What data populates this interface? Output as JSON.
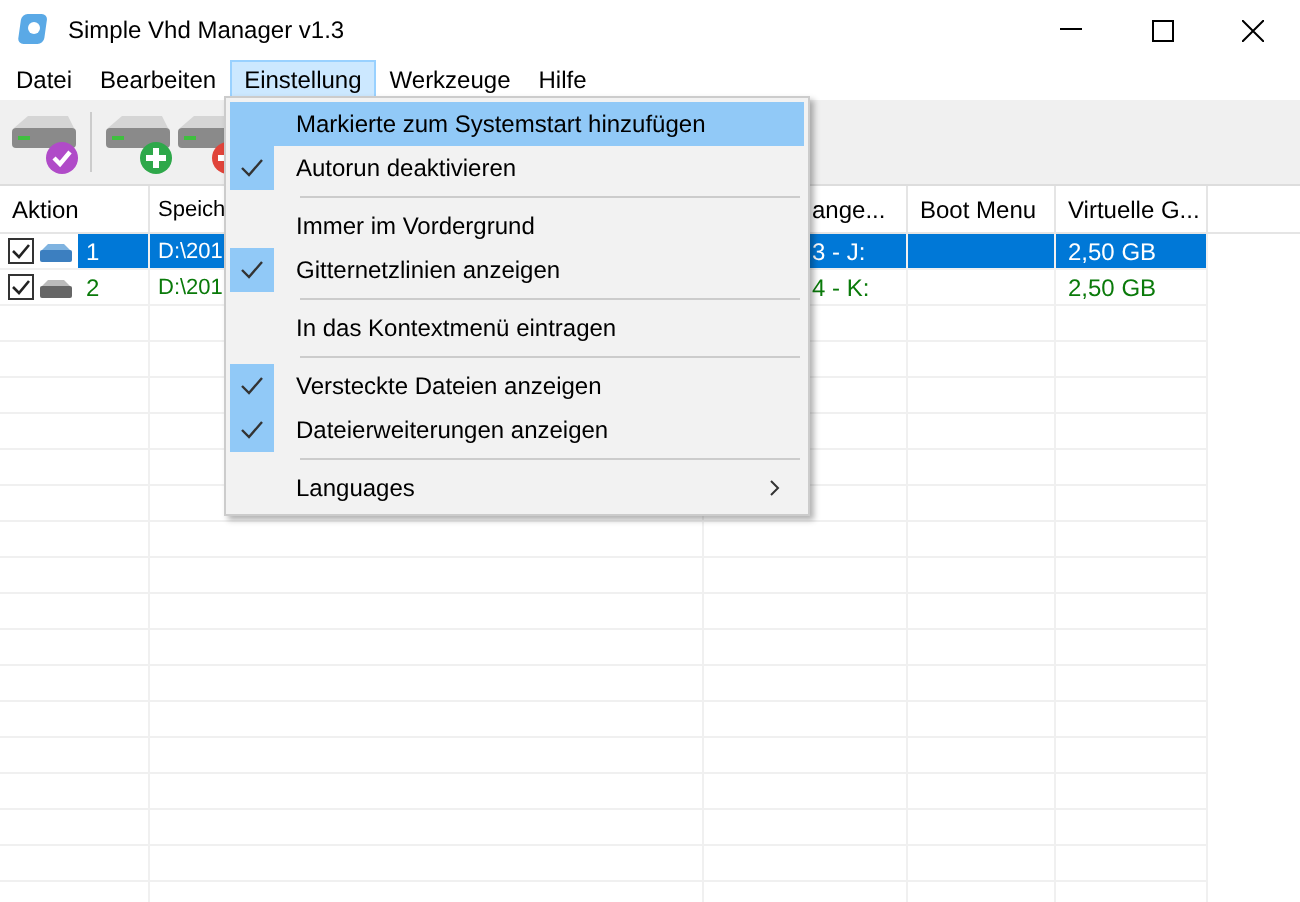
{
  "window": {
    "title": "Simple Vhd Manager v1.3"
  },
  "menu_bar": [
    {
      "label": "Datei",
      "selected": false
    },
    {
      "label": "Bearbeiten",
      "selected": false
    },
    {
      "label": "Einstellung",
      "selected": true
    },
    {
      "label": "Werkzeuge",
      "selected": false
    },
    {
      "label": "Hilfe",
      "selected": false
    }
  ],
  "toolbar": [
    {
      "kind": "check"
    },
    {
      "kind": "separator"
    },
    {
      "kind": "add"
    },
    {
      "kind": "remove"
    }
  ],
  "table": {
    "columns": [
      "Aktion",
      "Speich",
      "ange...",
      "Boot Menu",
      "Virtuelle G..."
    ],
    "rows": [
      {
        "checked": true,
        "selected": true,
        "number": "1",
        "path": "D:\\201",
        "drive": "3 - J:",
        "size": "2,50 GB"
      },
      {
        "checked": true,
        "selected": false,
        "number": "2",
        "path": "D:\\201",
        "drive": "4 - K:",
        "size": "2,50 GB"
      }
    ]
  },
  "dropdown": {
    "items": [
      {
        "kind": "item",
        "label": "Markierte zum Systemstart hinzufügen",
        "checked": false,
        "highlighted": true
      },
      {
        "kind": "item",
        "label": "Autorun deaktivieren",
        "checked": true,
        "highlighted": false
      },
      {
        "kind": "separator"
      },
      {
        "kind": "item",
        "label": "Immer im Vordergrund",
        "checked": false,
        "highlighted": false
      },
      {
        "kind": "item",
        "label": "Gitternetzlinien anzeigen",
        "checked": true,
        "highlighted": false
      },
      {
        "kind": "separator"
      },
      {
        "kind": "item",
        "label": "In das Kontextmenü eintragen",
        "checked": false,
        "highlighted": false
      },
      {
        "kind": "separator"
      },
      {
        "kind": "item",
        "label": "Versteckte Dateien anzeigen",
        "checked": true,
        "highlighted": false
      },
      {
        "kind": "item",
        "label": "Dateierweiterungen anzeigen",
        "checked": true,
        "highlighted": false
      },
      {
        "kind": "separator"
      },
      {
        "kind": "submenu",
        "label": "Languages",
        "checked": false,
        "highlighted": false
      }
    ]
  }
}
